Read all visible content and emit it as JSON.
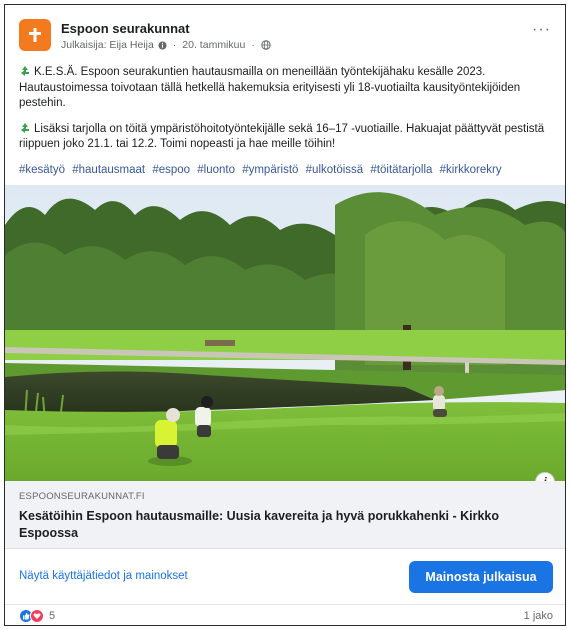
{
  "post": {
    "page_name": "Espoon seurakunnat",
    "published_by": "Julkaisija: Eija Heija",
    "date": "20. tammikuu",
    "more_label": "···",
    "paragraph_1": "K.E.S.Ä. Espoon seurakuntien hautausmailla on meneillään työntekijähaku kesälle 2023. Hautaustoimessa toivotaan tällä hetkellä hakemuksia erityisesti yli 18-vuotiailta kausityöntekijöiden pestehin.",
    "paragraph_2": "Lisäksi tarjolla on töitä ympäristöhoitotyöntekijälle sekä 16–17 -vuotiaille. Hakuajat päättyvät pestistä riippuen joko 21.1. tai 12.2. Toimi nopeasti ja hae meille töihin!",
    "hashtags": [
      "#kesätyö",
      "#hautausmaat",
      "#espoo",
      "#luonto",
      "#ympäristö",
      "#ulkotöissä",
      "#töitätarjolla",
      "#kirkkorekry"
    ],
    "info_label": "i"
  },
  "link": {
    "domain": "ESPOONSEURAKUNNAT.FI",
    "title": "Kesätöihin Espoon hautausmaille: Uusia kavereita ja hyvä porukkahenki - Kirkko Espoossa"
  },
  "actions": {
    "insights_label": "Näytä käyttäjätiedot ja mainokset",
    "promote_label": "Mainosta julkaisua"
  },
  "footer": {
    "reaction_count": "5",
    "shares": "1 jako"
  },
  "icons": {
    "avatar": "cross-logo-icon",
    "audience": "globe-icon",
    "emoji": "recycle-icon",
    "reactions": [
      "like-icon",
      "love-icon"
    ]
  },
  "colors": {
    "brand_orange": "#f47a20",
    "accent_blue": "#1b74e4",
    "hashtag_blue": "#385898",
    "love_red": "#f33e58"
  }
}
